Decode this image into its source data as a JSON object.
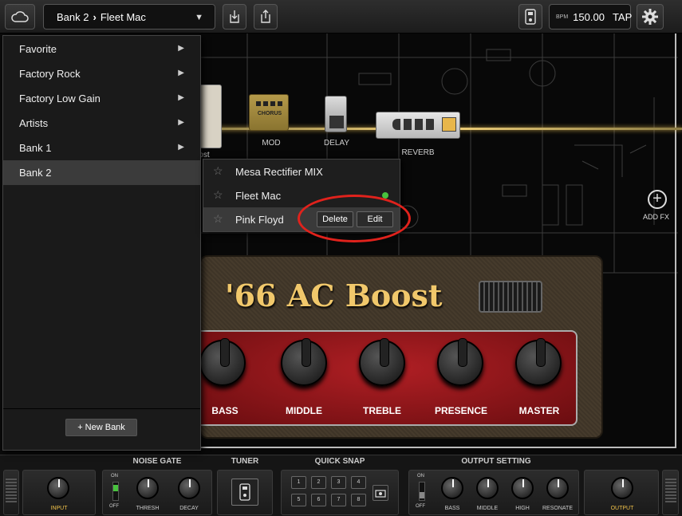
{
  "topbar": {
    "cloud_icon": "cloud-icon",
    "preset_bank": "Bank 2",
    "preset_name": "Fleet Mac",
    "import_icon": "download-icon",
    "share_icon": "share-icon",
    "pedal_icon": "pedal-controller-icon",
    "bpm_label": "BPM",
    "bpm_value": "150.00",
    "tap_label": "TAP",
    "settings_icon": "gear-icon"
  },
  "signal_chain": {
    "effects": [
      {
        "label": "ost"
      },
      {
        "label": "MOD"
      },
      {
        "label": "DELAY"
      },
      {
        "label": "REVERB"
      }
    ],
    "add_fx_label": "ADD FX",
    "chorus_text": "CHORUS"
  },
  "amp": {
    "name": "'66 AC Boost",
    "knobs": [
      "BASS",
      "MIDDLE",
      "TREBLE",
      "PRESENCE",
      "MASTER"
    ]
  },
  "preset_menu": {
    "items": [
      {
        "label": "Favorite",
        "has_submenu": true
      },
      {
        "label": "Factory Rock",
        "has_submenu": true
      },
      {
        "label": "Factory Low Gain",
        "has_submenu": true
      },
      {
        "label": "Artists",
        "has_submenu": true
      },
      {
        "label": "Bank 1",
        "has_submenu": true
      },
      {
        "label": "Bank 2",
        "has_submenu": false,
        "selected": true
      }
    ],
    "new_bank_label": "+ New Bank"
  },
  "bank_submenu": {
    "items": [
      {
        "label": "Mesa Rectifier MIX",
        "active": false
      },
      {
        "label": "Fleet Mac",
        "active": true
      },
      {
        "label": "Pink Floyd",
        "active": false
      }
    ],
    "delete_label": "Delete",
    "edit_label": "Edit"
  },
  "bottom_rack": {
    "input_label": "INPUT",
    "noise_gate_title": "NOISE GATE",
    "noise_gate_on": "ON",
    "noise_gate_off": "OFF",
    "thresh_label": "THRESH",
    "decay_label": "DECAY",
    "tuner_title": "TUNER",
    "quick_snap_title": "QUICK SNAP",
    "snap_slots": [
      "1",
      "2",
      "3",
      "4",
      "5",
      "6",
      "7",
      "8"
    ],
    "output_setting_title": "OUTPUT SETTING",
    "out_on": "ON",
    "out_off": "OFF",
    "out_knobs": [
      "BASS",
      "MIDDLE",
      "HIGH",
      "RESONATE"
    ],
    "output_label": "OUTPUT"
  },
  "colors": {
    "accent_gold": "#f1c86b",
    "panel_red": "#b01f24",
    "callout_red": "#e0221c",
    "active_dot": "#48c23e"
  }
}
